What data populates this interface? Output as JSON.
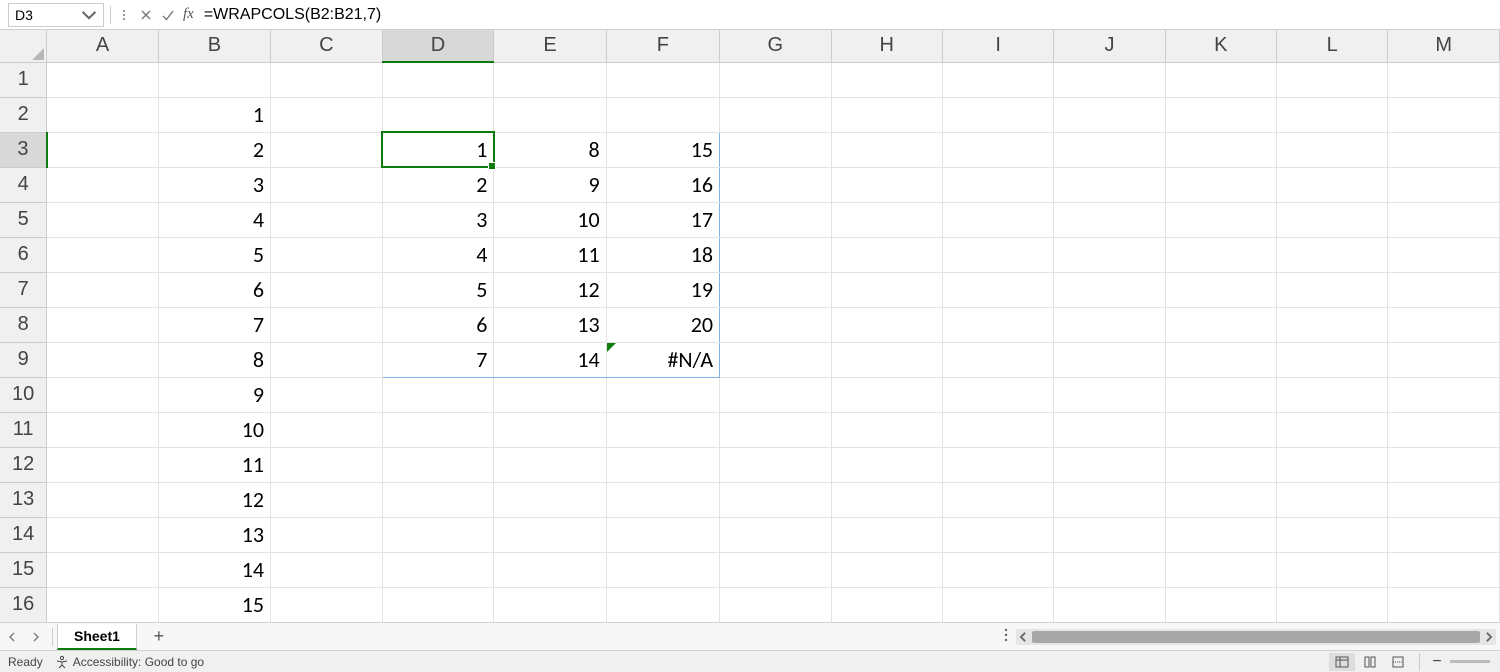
{
  "formula_bar": {
    "name_box_value": "D3",
    "formula_value": "=WRAPCOLS(B2:B21,7)"
  },
  "columns": [
    "A",
    "B",
    "C",
    "D",
    "E",
    "F",
    "G",
    "H",
    "I",
    "J",
    "K",
    "L",
    "M"
  ],
  "rows": [
    "1",
    "2",
    "3",
    "4",
    "5",
    "6",
    "7",
    "8",
    "9",
    "10",
    "11",
    "12",
    "13",
    "14",
    "15",
    "16"
  ],
  "active_cell": "D3",
  "spill_range": "D3:F9",
  "cells": {
    "B2": "1",
    "B3": "2",
    "B4": "3",
    "B5": "4",
    "B6": "5",
    "B7": "6",
    "B8": "7",
    "B9": "8",
    "B10": "9",
    "B11": "10",
    "B12": "11",
    "B13": "12",
    "B14": "13",
    "B15": "14",
    "B16": "15",
    "D3": "1",
    "D4": "2",
    "D5": "3",
    "D6": "4",
    "D7": "5",
    "D8": "6",
    "D9": "7",
    "E3": "8",
    "E4": "9",
    "E5": "10",
    "E6": "11",
    "E7": "12",
    "E8": "13",
    "E9": "14",
    "F3": "15",
    "F4": "16",
    "F5": "17",
    "F6": "18",
    "F7": "19",
    "F8": "20",
    "F9": "#N/A"
  },
  "error_cells": [
    "F9"
  ],
  "tabs": {
    "sheet1": "Sheet1"
  },
  "status": {
    "ready": "Ready",
    "accessibility": "Accessibility: Good to go"
  }
}
